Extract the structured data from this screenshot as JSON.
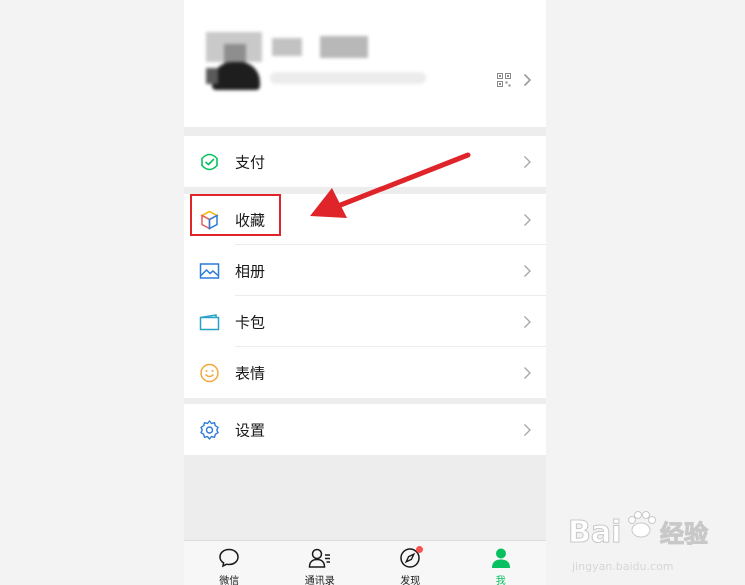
{
  "profile": {
    "avatar": "avatar-blurred",
    "name": "",
    "wechat_id": ""
  },
  "menu": [
    {
      "label": "支付",
      "icon": "wallet-icon",
      "color": "#07c160"
    },
    {
      "label": "收藏",
      "icon": "cube-icon",
      "color": "#f4b400"
    },
    {
      "label": "相册",
      "icon": "image-icon",
      "color": "#2b7bd8"
    },
    {
      "label": "卡包",
      "icon": "card-icon",
      "color": "#2aa1c6"
    },
    {
      "label": "表情",
      "icon": "smile-icon",
      "color": "#f2a93b"
    },
    {
      "label": "设置",
      "icon": "gear-icon",
      "color": "#2b7bd8"
    }
  ],
  "tabs": [
    {
      "label": "微信",
      "icon": "chat-icon"
    },
    {
      "label": "通讯录",
      "icon": "contacts-icon"
    },
    {
      "label": "发现",
      "icon": "compass-icon",
      "badge": true
    },
    {
      "label": "我",
      "icon": "person-icon",
      "active": true
    }
  ],
  "annotation": {
    "color": "#e0252a",
    "highlight": "收藏"
  },
  "watermark": {
    "logo": "Bai 经验",
    "url": "jingyan.baidu.com"
  }
}
